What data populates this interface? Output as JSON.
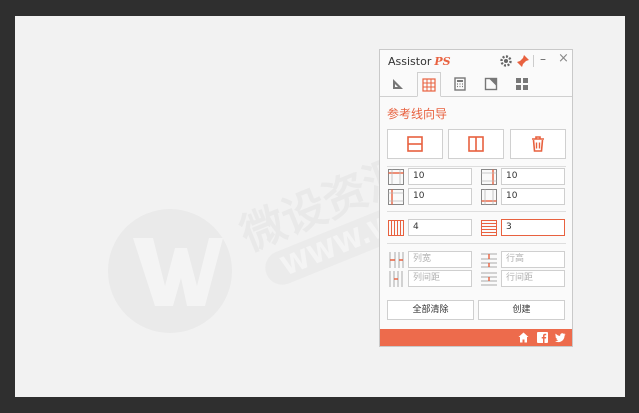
{
  "app": {
    "name": "Assistor",
    "name_suffix": "PS"
  },
  "window": {
    "minimize_label": "–",
    "close_label": "×"
  },
  "tabs": [
    {
      "name": "ruler-tab",
      "active": false
    },
    {
      "name": "grid-tab",
      "active": true
    },
    {
      "name": "calculator-tab",
      "active": false
    },
    {
      "name": "corner-tab",
      "active": false
    },
    {
      "name": "tiles-tab",
      "active": false
    }
  ],
  "guide_wizard": {
    "title": "参考线向导",
    "buttons": [
      "horizontal-guide",
      "vertical-guide",
      "delete-guides"
    ]
  },
  "margins": {
    "top": "10",
    "right": "10",
    "left": "10",
    "bottom": "10"
  },
  "grid": {
    "columns": "4",
    "rows": "3"
  },
  "layout": {
    "column_width_placeholder": "列宽",
    "row_height_placeholder": "行高",
    "column_gap_placeholder": "列间距",
    "row_gap_placeholder": "行间距"
  },
  "actions": {
    "clear_all": "全部清除",
    "create": "创建"
  },
  "colors": {
    "accent": "#e8613f",
    "footer": "#ed6b4c",
    "frame": "#2f2f2f",
    "canvas": "#f2f2f2"
  },
  "watermark": {
    "text_cn": "微设资源库",
    "text_url": "WWW.WSZYK.COM"
  }
}
